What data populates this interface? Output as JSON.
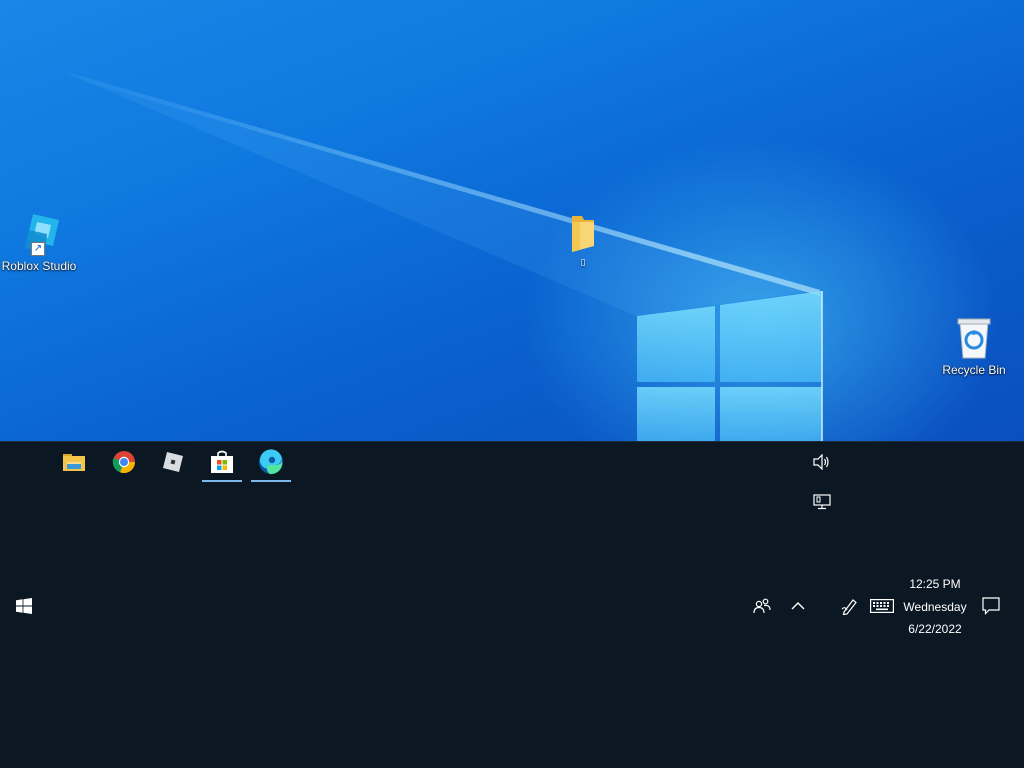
{
  "desktop": {
    "icons": [
      {
        "label": "Roblox Studio",
        "icon": "roblox-studio-icon",
        "shortcut": true
      },
      {
        "label": "",
        "icon": "folder-icon",
        "shortcut": false
      },
      {
        "label": "Recycle Bin",
        "icon": "recycle-bin-icon",
        "shortcut": false
      }
    ]
  },
  "taskbar": {
    "orientation": "expanded-bottom",
    "start": {
      "icon": "windows-logo-icon"
    },
    "pinned_apps": [
      {
        "name": "File Explorer",
        "icon": "file-explorer-icon",
        "active": false
      },
      {
        "name": "Google Chrome",
        "icon": "chrome-icon",
        "active": false
      },
      {
        "name": "Roblox",
        "icon": "roblox-icon",
        "active": false
      },
      {
        "name": "Microsoft Store",
        "icon": "store-icon",
        "active": true
      },
      {
        "name": "Microsoft Edge",
        "icon": "edge-icon",
        "active": true
      }
    ],
    "tray": {
      "icons": [
        "volume-icon",
        "network-icon",
        "people-icon",
        "chevron-up-icon",
        "pen-workspace-icon",
        "touch-keyboard-icon",
        "notification-icon"
      ],
      "clock": {
        "time": "12:25 PM",
        "day": "Wednesday",
        "date": "6/22/2022"
      }
    }
  },
  "colors": {
    "desktop_blue": "#0f79e0",
    "taskbar_bg": "#0b1823",
    "active_indicator": "#7db8e8"
  }
}
